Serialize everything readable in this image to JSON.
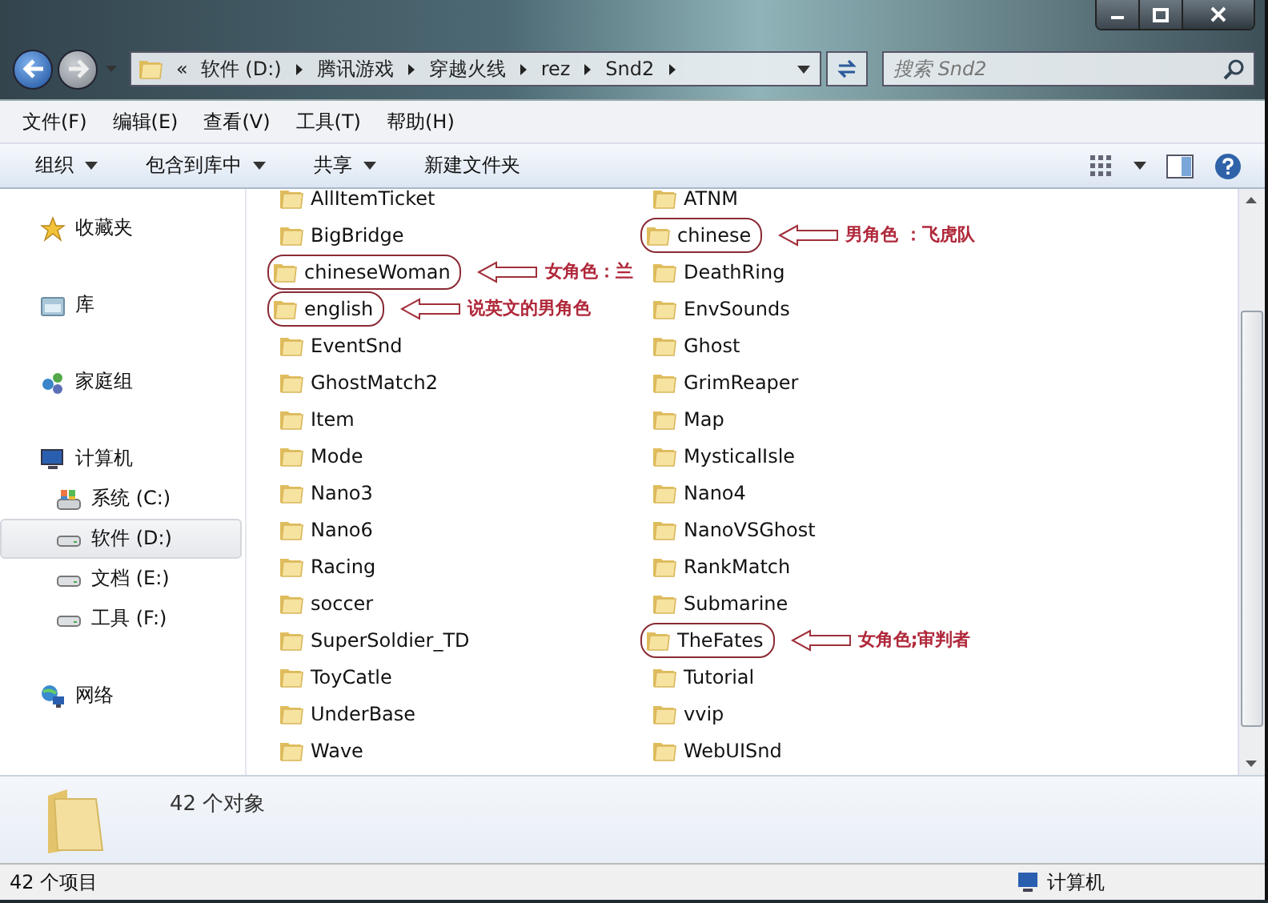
{
  "address": {
    "overflow": "«",
    "crumbs": [
      "软件 (D:)",
      "腾讯游戏",
      "穿越火线",
      "rez",
      "Snd2"
    ]
  },
  "search": {
    "placeholder": "搜索 Snd2"
  },
  "menu": [
    "文件(F)",
    "编辑(E)",
    "查看(V)",
    "工具(T)",
    "帮助(H)"
  ],
  "toolbar": [
    {
      "label": "组织",
      "dropdown": true
    },
    {
      "label": "包含到库中",
      "dropdown": true
    },
    {
      "label": "共享",
      "dropdown": true
    },
    {
      "label": "新建文件夹",
      "dropdown": false
    }
  ],
  "sidebar": {
    "items": [
      {
        "label": "收藏夹",
        "kind": "favorites",
        "selected": false
      },
      {
        "label": "库",
        "kind": "library",
        "selected": false
      },
      {
        "label": "家庭组",
        "kind": "homegroup",
        "selected": false
      },
      {
        "label": "计算机",
        "kind": "computer",
        "selected": false,
        "children": [
          {
            "label": "系统 (C:)",
            "kind": "system-drive",
            "selected": false
          },
          {
            "label": "软件 (D:)",
            "kind": "drive",
            "selected": true
          },
          {
            "label": "文档 (E:)",
            "kind": "drive",
            "selected": false
          },
          {
            "label": "工具 (F:)",
            "kind": "drive",
            "selected": false
          }
        ]
      },
      {
        "label": "网络",
        "kind": "network",
        "selected": false
      }
    ]
  },
  "files": [
    {
      "name": "AllItemTicket",
      "circled": false
    },
    {
      "name": "ATNM",
      "circled": false
    },
    {
      "name": "BigBridge",
      "circled": false
    },
    {
      "name": "chinese",
      "circled": true,
      "note": "男角色 ：飞虎队"
    },
    {
      "name": "chineseWoman",
      "circled": true,
      "note": "女角色：兰"
    },
    {
      "name": "DeathRing",
      "circled": false
    },
    {
      "name": "english",
      "circled": true,
      "note": "说英文的男角色"
    },
    {
      "name": "EnvSounds",
      "circled": false
    },
    {
      "name": "EventSnd",
      "circled": false
    },
    {
      "name": "Ghost",
      "circled": false
    },
    {
      "name": "GhostMatch2",
      "circled": false
    },
    {
      "name": "GrimReaper",
      "circled": false
    },
    {
      "name": "Item",
      "circled": false
    },
    {
      "name": "Map",
      "circled": false
    },
    {
      "name": "Mode",
      "circled": false
    },
    {
      "name": "MysticalIsle",
      "circled": false
    },
    {
      "name": "Nano3",
      "circled": false
    },
    {
      "name": "Nano4",
      "circled": false
    },
    {
      "name": "Nano6",
      "circled": false
    },
    {
      "name": "NanoVSGhost",
      "circled": false
    },
    {
      "name": "Racing",
      "circled": false
    },
    {
      "name": "RankMatch",
      "circled": false
    },
    {
      "name": "soccer",
      "circled": false
    },
    {
      "name": "Submarine",
      "circled": false
    },
    {
      "name": "SuperSoldier_TD",
      "circled": false
    },
    {
      "name": "TheFates",
      "circled": true,
      "note": "女角色;审判者"
    },
    {
      "name": "ToyCatle",
      "circled": false
    },
    {
      "name": "Tutorial",
      "circled": false
    },
    {
      "name": "UnderBase",
      "circled": false
    },
    {
      "name": "vvip",
      "circled": false
    },
    {
      "name": "Wave",
      "circled": false
    },
    {
      "name": "WebUISnd",
      "circled": false
    }
  ],
  "details": {
    "count": "42 个对象"
  },
  "status_bar": {
    "items": "42 个项目",
    "location": "计算机"
  }
}
